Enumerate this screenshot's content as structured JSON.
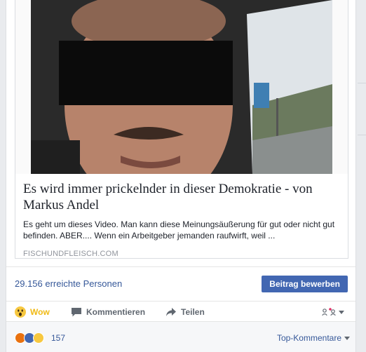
{
  "link": {
    "title": "Es wird immer prickelnder in dieser Demokratie - von Markus Andel",
    "description": "Es geht um dieses Video. Man kann diese Meinungsäußerung für gut oder nicht gut befinden. ABER.... Wenn ein Arbeitgeber jemanden raufwirft, weil ...",
    "domain": "FISCHUNDFLEISCH.COM",
    "thumbnail": "video-still-icon"
  },
  "stats": {
    "reach": "29.156 erreichte Personen",
    "boost_label": "Beitrag bewerben"
  },
  "actions": {
    "wow": "Wow",
    "comment": "Kommentieren",
    "share": "Teilen"
  },
  "reactions": {
    "count": "157",
    "sort_label": "Top-Kommentare",
    "icons": [
      "angry-icon",
      "like-icon",
      "wow-icon"
    ]
  },
  "colors": {
    "link": "#365899",
    "button": "#4267b2",
    "wow": "#f0ba15"
  }
}
